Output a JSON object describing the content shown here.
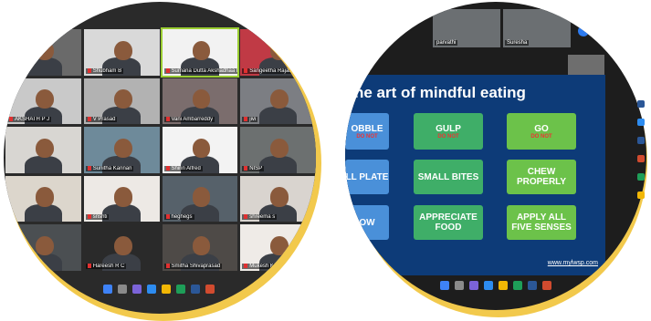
{
  "left": {
    "participants": [
      {
        "name": "",
        "color": "#6a6a6a"
      },
      {
        "name": "Shubham B",
        "color": "#d9d9d9"
      },
      {
        "name": "Sumana Dutta Akshadhaa R",
        "color": "#f2f2f2",
        "active": true
      },
      {
        "name": "Sangeetha Rajath",
        "color": "#c03a45"
      },
      {
        "name": "AKSHATH P J",
        "color": "#c9c9c9"
      },
      {
        "name": "V Prasad",
        "color": "#b2b2b2"
      },
      {
        "name": "Vani Ambarreddy",
        "color": "#7b6d6d"
      },
      {
        "name": "jivi",
        "color": "#7c7e83"
      },
      {
        "name": "",
        "color": "#d8d6d2"
      },
      {
        "name": "Sunitha Kannan",
        "color": "#6e8a9a"
      },
      {
        "name": "Shirin Alfred",
        "color": "#f3f3f3"
      },
      {
        "name": "NISP",
        "color": "#6c7070"
      },
      {
        "name": "",
        "color": "#dcd6cc"
      },
      {
        "name": "srishti",
        "color": "#ede9e5"
      },
      {
        "name": "heghegs",
        "color": "#56616a"
      },
      {
        "name": "shreema s",
        "color": "#d9d4cf"
      },
      {
        "name": "",
        "color": "#4b4f52"
      },
      {
        "name": "Hareesh R C",
        "color": "#2a2a2a"
      },
      {
        "name": "Smitha Shivaprasad",
        "color": "#4e4a47"
      },
      {
        "name": "Mukesh Kumar",
        "color": "#efebe7"
      }
    ]
  },
  "right": {
    "thumbnails": [
      {
        "name": "parvathi"
      },
      {
        "name": "Suresha"
      }
    ],
    "slide": {
      "title": "he art of mindful eating",
      "boxes": [
        {
          "label": "OBBLE",
          "sub": "DO NOT"
        },
        {
          "label": "GULP",
          "sub": "DO NOT"
        },
        {
          "label": "GO",
          "sub": "DO NOT"
        },
        {
          "label": "LL PLATE",
          "sub": ""
        },
        {
          "label": "SMALL BITES",
          "sub": ""
        },
        {
          "label": "CHEW PROPERLY",
          "sub": ""
        },
        {
          "label": "OW",
          "sub": ""
        },
        {
          "label": "APPRECIATE FOOD",
          "sub": ""
        },
        {
          "label": "APPLY ALL FIVE SENSES",
          "sub": ""
        }
      ],
      "url": "www.mylwsp.com"
    }
  },
  "colors": {
    "ring": "#f2c94c",
    "slide_bg": "#0d3b78",
    "box_blue": "#4a90d9",
    "box_green": "#3fae68",
    "box_lightgreen": "#6cc24a"
  }
}
